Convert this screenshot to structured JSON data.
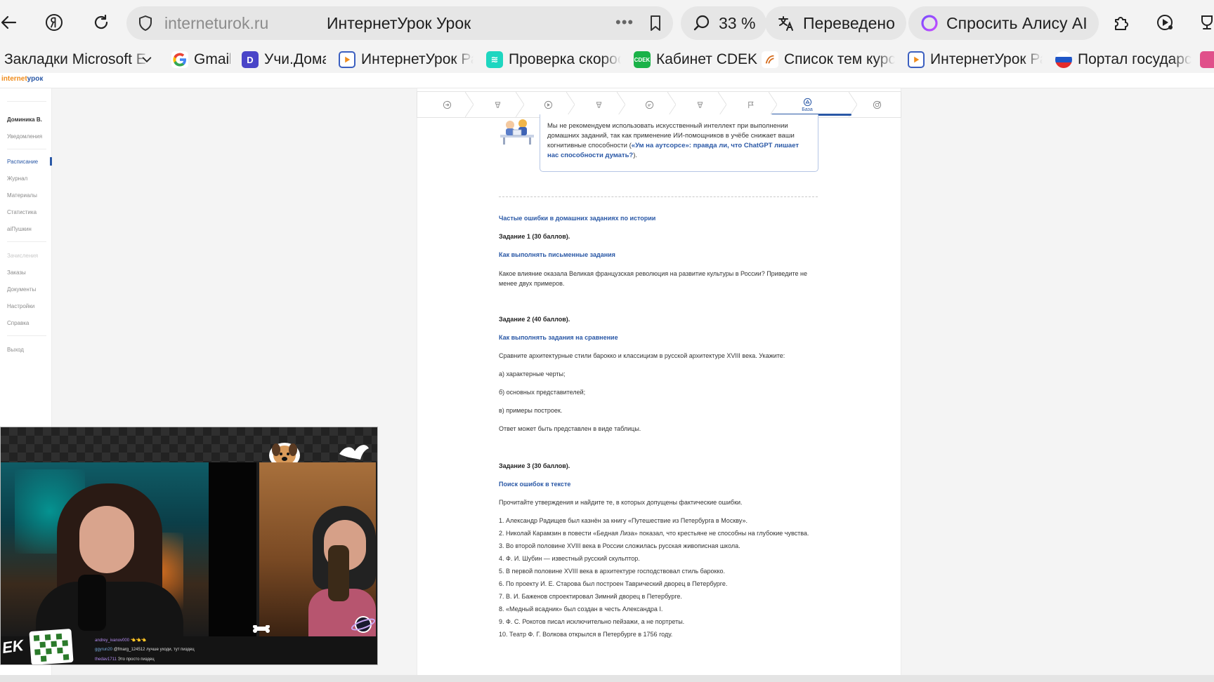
{
  "browser": {
    "url_domain": "interneturok.ru",
    "page_title": "ИнтернетУрок Урок",
    "more_icon": "•••",
    "zoom": "33 %",
    "translated_label": "Переведено",
    "alice_label": "Спросить Алису AI",
    "icons": [
      "back-arrow-icon",
      "yandex-icon",
      "reload-icon",
      "shield-icon",
      "bookmark-icon",
      "search-zoom-icon",
      "translate-icon",
      "alice-icon",
      "extensions-icon",
      "media-icon",
      "cup-icon"
    ]
  },
  "bookmarks": [
    {
      "label": "Закладки Microsoft E",
      "icon": "folder-icon"
    },
    {
      "label": "Gmail",
      "icon": "google-icon"
    },
    {
      "label": "Учи.Дома",
      "icon": "uchi-icon"
    },
    {
      "label": "ИнтернетУрок Ра",
      "icon": "play-icon"
    },
    {
      "label": "Проверка скорос",
      "icon": "speedtest-icon"
    },
    {
      "label": "Кабинет CDEK",
      "icon": "cdek-icon"
    },
    {
      "label": "Список тем курса",
      "icon": "list-icon"
    },
    {
      "label": "ИнтернетУрок Ра",
      "icon": "play-icon"
    },
    {
      "label": "Портал государс",
      "icon": "gos-icon"
    }
  ],
  "site": {
    "logo_part1": "internet",
    "logo_part2": "урок"
  },
  "sidebar": {
    "user": "Доминика В.",
    "notifications": "Уведомления",
    "items": [
      "Расписание",
      "Журнал",
      "Материалы",
      "Статистика",
      "aiПушкин"
    ],
    "muted": "Зачисления",
    "items2": [
      "Заказы",
      "Документы",
      "Настройки",
      "Справка"
    ],
    "exit": "Выход"
  },
  "steps": {
    "active_label": "База"
  },
  "tip": {
    "text": "Мы не рекомендуем использовать искусственный интеллект при выполнении домашних заданий, так как применение ИИ-помощников в учёбе снижает ваши когнитивные способности (",
    "link": "«Ум на аутсорсе»: правда ли, что ChatGPT лишает нас способности думать?",
    "tail": ")."
  },
  "content": {
    "section_title": "Частые ошибки в домашних заданиях по истории",
    "task1_title": "Задание 1 (30 баллов).",
    "task1_link": "Как выполнять письменные задания",
    "task1_text": "Какое влияние оказала Великая французская революция на развитие культуры в России? Приведите не менее двух примеров.",
    "task2_title": "Задание 2 (40 баллов).",
    "task2_link": "Как выполнять задания на сравнение",
    "task2_text": "Сравните архитектурные стили барокко и классицизм в русской архитектуре XVIII века. Укажите:",
    "task2_a": "а) характерные черты;",
    "task2_b": "б) основных представителей;",
    "task2_c": "в) примеры построек.",
    "task2_note": "Ответ может быть представлен в виде таблицы.",
    "task3_title": "Задание 3 (30 баллов).",
    "task3_link": "Поиск ошибок в тексте",
    "task3_text": "Прочитайте утверждения и найдите те, в которых допущены фактические ошибки.",
    "statements": [
      "1. Александр Радищев был казнён за книгу «Путешествие из Петербурга в Москву».",
      "2. Николай Карамзин в повести «Бедная Лиза» показал, что крестьяне не способны на глубокие чувства.",
      "3. Во второй половине XVIII века в России сложилась русская живописная школа.",
      "4. Ф. И. Шубин — известный русский скульптор.",
      "5. В первой половине XVIII века в архитектуре господствовал стиль барокко.",
      "6. По проекту И. Е. Старова был построен Таврический дворец в Петербурге.",
      "7. В. И. Баженов спроектировал Зимний дворец в Петербурге.",
      "8. «Медный всадник» был создан в честь Александра I.",
      "9. Ф. С. Рокотов писал исключительно пейзажи, а не портреты.",
      "10. Театр Ф. Г. Волкова открылся в Петербурге в 1756 году."
    ]
  },
  "stream": {
    "tag": "EK",
    "chat": [
      {
        "name": "andrey_ivanov000",
        "msg": "👈👈👈"
      },
      {
        "name": "ggyrun20",
        "msg": "@fmarg_124512 лучше уходи, тут пиздец"
      },
      {
        "name": "thedav1711",
        "msg": "Это просто пиздец"
      }
    ]
  }
}
